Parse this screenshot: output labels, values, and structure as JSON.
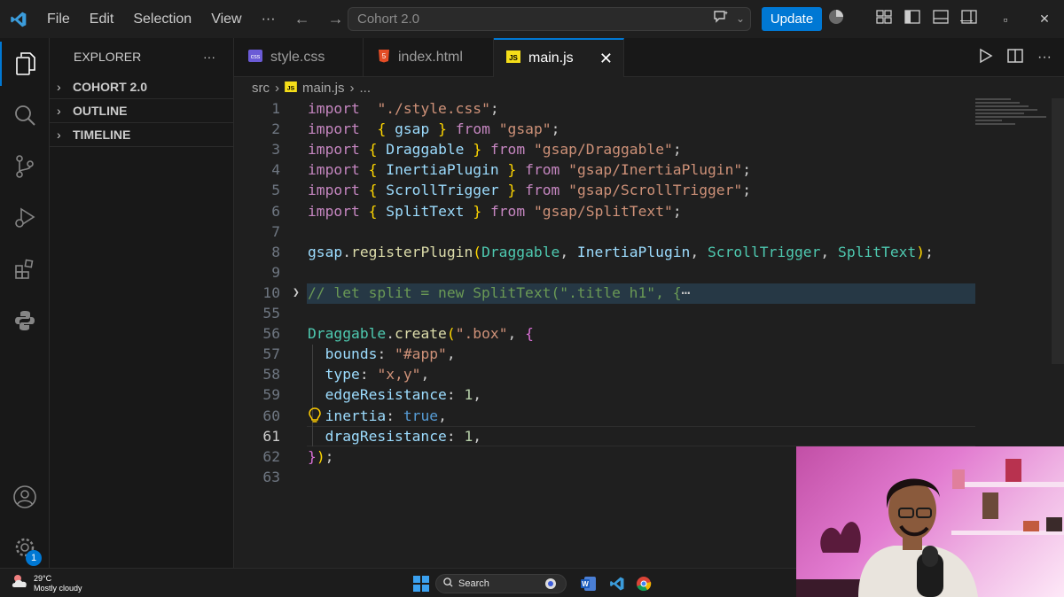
{
  "titlebar": {
    "menu": [
      "File",
      "Edit",
      "Selection",
      "View"
    ],
    "more": "···",
    "search_text": "Cohort 2.0",
    "update_label": "Update"
  },
  "sidebar": {
    "title": "EXPLORER",
    "more": "···",
    "sections": [
      "COHORT 2.0",
      "OUTLINE",
      "TIMELINE"
    ]
  },
  "tabs": [
    {
      "label": "style.css",
      "icon": "css-file-icon"
    },
    {
      "label": "index.html",
      "icon": "html-file-icon"
    },
    {
      "label": "main.js",
      "icon": "js-file-icon",
      "active": true
    }
  ],
  "breadcrumb": {
    "folder": "src",
    "file": "main.js",
    "more": "..."
  },
  "editor": {
    "line_numbers": [
      "1",
      "2",
      "3",
      "4",
      "5",
      "6",
      "7",
      "8",
      "9",
      "10",
      "55",
      "56",
      "57",
      "58",
      "59",
      "60",
      "61",
      "62",
      "63"
    ],
    "current_line": "61",
    "lines": [
      [
        [
          "kw",
          "import"
        ],
        [
          "",
          "  "
        ],
        [
          "str",
          "\"./style.css\""
        ],
        [
          "",
          ";"
        ]
      ],
      [
        [
          "kw",
          "import"
        ],
        [
          "",
          "  "
        ],
        [
          "br1",
          "{"
        ],
        [
          "",
          " "
        ],
        [
          "id",
          "gsap"
        ],
        [
          "",
          " "
        ],
        [
          "br1",
          "}"
        ],
        [
          "",
          " "
        ],
        [
          "kw",
          "from"
        ],
        [
          "",
          " "
        ],
        [
          "str",
          "\"gsap\""
        ],
        [
          "",
          ";"
        ]
      ],
      [
        [
          "kw",
          "import"
        ],
        [
          "",
          " "
        ],
        [
          "br1",
          "{"
        ],
        [
          "",
          " "
        ],
        [
          "id",
          "Draggable"
        ],
        [
          "",
          " "
        ],
        [
          "br1",
          "}"
        ],
        [
          "",
          " "
        ],
        [
          "kw",
          "from"
        ],
        [
          "",
          " "
        ],
        [
          "str",
          "\"gsap/Draggable\""
        ],
        [
          "",
          ";"
        ]
      ],
      [
        [
          "kw",
          "import"
        ],
        [
          "",
          " "
        ],
        [
          "br1",
          "{"
        ],
        [
          "",
          " "
        ],
        [
          "id",
          "InertiaPlugin"
        ],
        [
          "",
          " "
        ],
        [
          "br1",
          "}"
        ],
        [
          "",
          " "
        ],
        [
          "kw",
          "from"
        ],
        [
          "",
          " "
        ],
        [
          "str",
          "\"gsap/InertiaPlugin\""
        ],
        [
          "",
          ";"
        ]
      ],
      [
        [
          "kw",
          "import"
        ],
        [
          "",
          " "
        ],
        [
          "br1",
          "{"
        ],
        [
          "",
          " "
        ],
        [
          "id",
          "ScrollTrigger"
        ],
        [
          "",
          " "
        ],
        [
          "br1",
          "}"
        ],
        [
          "",
          " "
        ],
        [
          "kw",
          "from"
        ],
        [
          "",
          " "
        ],
        [
          "str",
          "\"gsap/ScrollTrigger\""
        ],
        [
          "",
          ";"
        ]
      ],
      [
        [
          "kw",
          "import"
        ],
        [
          "",
          " "
        ],
        [
          "br1",
          "{"
        ],
        [
          "",
          " "
        ],
        [
          "id",
          "SplitText"
        ],
        [
          "",
          " "
        ],
        [
          "br1",
          "}"
        ],
        [
          "",
          " "
        ],
        [
          "kw",
          "from"
        ],
        [
          "",
          " "
        ],
        [
          "str",
          "\"gsap/SplitText\""
        ],
        [
          "",
          ";"
        ]
      ],
      [],
      [
        [
          "id",
          "gsap"
        ],
        [
          "",
          "."
        ],
        [
          "fn",
          "registerPlugin"
        ],
        [
          "br1",
          "("
        ],
        [
          "cls",
          "Draggable"
        ],
        [
          "",
          ", "
        ],
        [
          "id",
          "InertiaPlugin"
        ],
        [
          "",
          ", "
        ],
        [
          "cls",
          "ScrollTrigger"
        ],
        [
          "",
          ", "
        ],
        [
          "cls",
          "SplitText"
        ],
        [
          "br1",
          ")"
        ],
        [
          "",
          ";"
        ]
      ],
      [],
      [
        [
          "com",
          "// let split = new SplitText(\".title h1\", {"
        ],
        [
          "",
          "⋯"
        ]
      ],
      [],
      [
        [
          "cls",
          "Draggable"
        ],
        [
          "",
          "."
        ],
        [
          "fn",
          "create"
        ],
        [
          "br1",
          "("
        ],
        [
          "str",
          "\".box\""
        ],
        [
          "",
          ", "
        ],
        [
          "br2",
          "{"
        ]
      ],
      [
        [
          "",
          "  "
        ],
        [
          "prop",
          "bounds"
        ],
        [
          "",
          ": "
        ],
        [
          "str",
          "\"#app\""
        ],
        [
          "",
          ","
        ]
      ],
      [
        [
          "",
          "  "
        ],
        [
          "prop",
          "type"
        ],
        [
          "",
          ": "
        ],
        [
          "str",
          "\"x,y\""
        ],
        [
          "",
          ","
        ]
      ],
      [
        [
          "",
          "  "
        ],
        [
          "prop",
          "edgeResistance"
        ],
        [
          "",
          ": "
        ],
        [
          "num",
          "1"
        ],
        [
          "",
          ","
        ]
      ],
      [
        [
          "",
          "  "
        ],
        [
          "prop",
          "inertia"
        ],
        [
          "",
          ": "
        ],
        [
          "bool",
          "true"
        ],
        [
          "",
          ","
        ]
      ],
      [
        [
          "",
          "  "
        ],
        [
          "prop",
          "dragResistance"
        ],
        [
          "",
          ": "
        ],
        [
          "num",
          "1"
        ],
        [
          "",
          ","
        ]
      ],
      [
        [
          "br2",
          "}"
        ],
        [
          "br1",
          ")"
        ],
        [
          "",
          ";"
        ]
      ],
      []
    ]
  },
  "taskbar": {
    "temperature": "29°C",
    "weather": "Mostly cloudy",
    "search_label": "Search",
    "settings_badge": "1"
  }
}
